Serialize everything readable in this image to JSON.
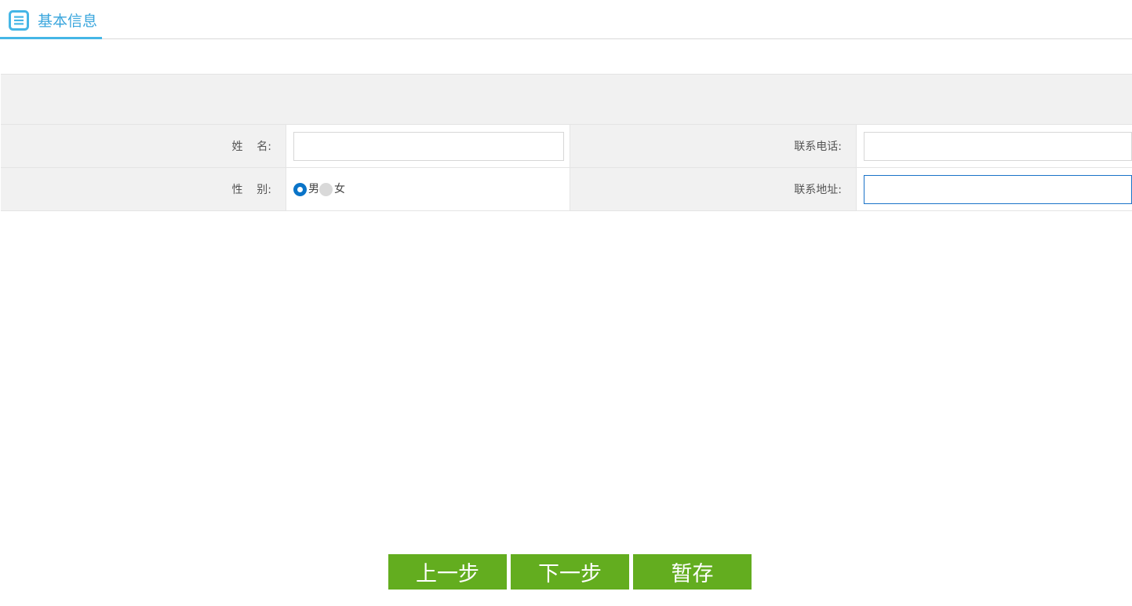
{
  "header": {
    "title": "基本信息",
    "icon": "list-document-icon",
    "accent_color": "#45b6e6"
  },
  "form": {
    "rows": [
      {
        "left_label": "姓    名:",
        "left_value": "",
        "right_label": "联系电话:",
        "right_value": ""
      },
      {
        "left_label": "性    别:",
        "right_label": "联系地址:",
        "right_value": ""
      }
    ],
    "gender": {
      "options": [
        "男",
        "女"
      ],
      "selected": "男"
    }
  },
  "buttons": {
    "prev": "上一步",
    "next": "下一步",
    "save": "暂存",
    "color": "#63ad1f"
  }
}
